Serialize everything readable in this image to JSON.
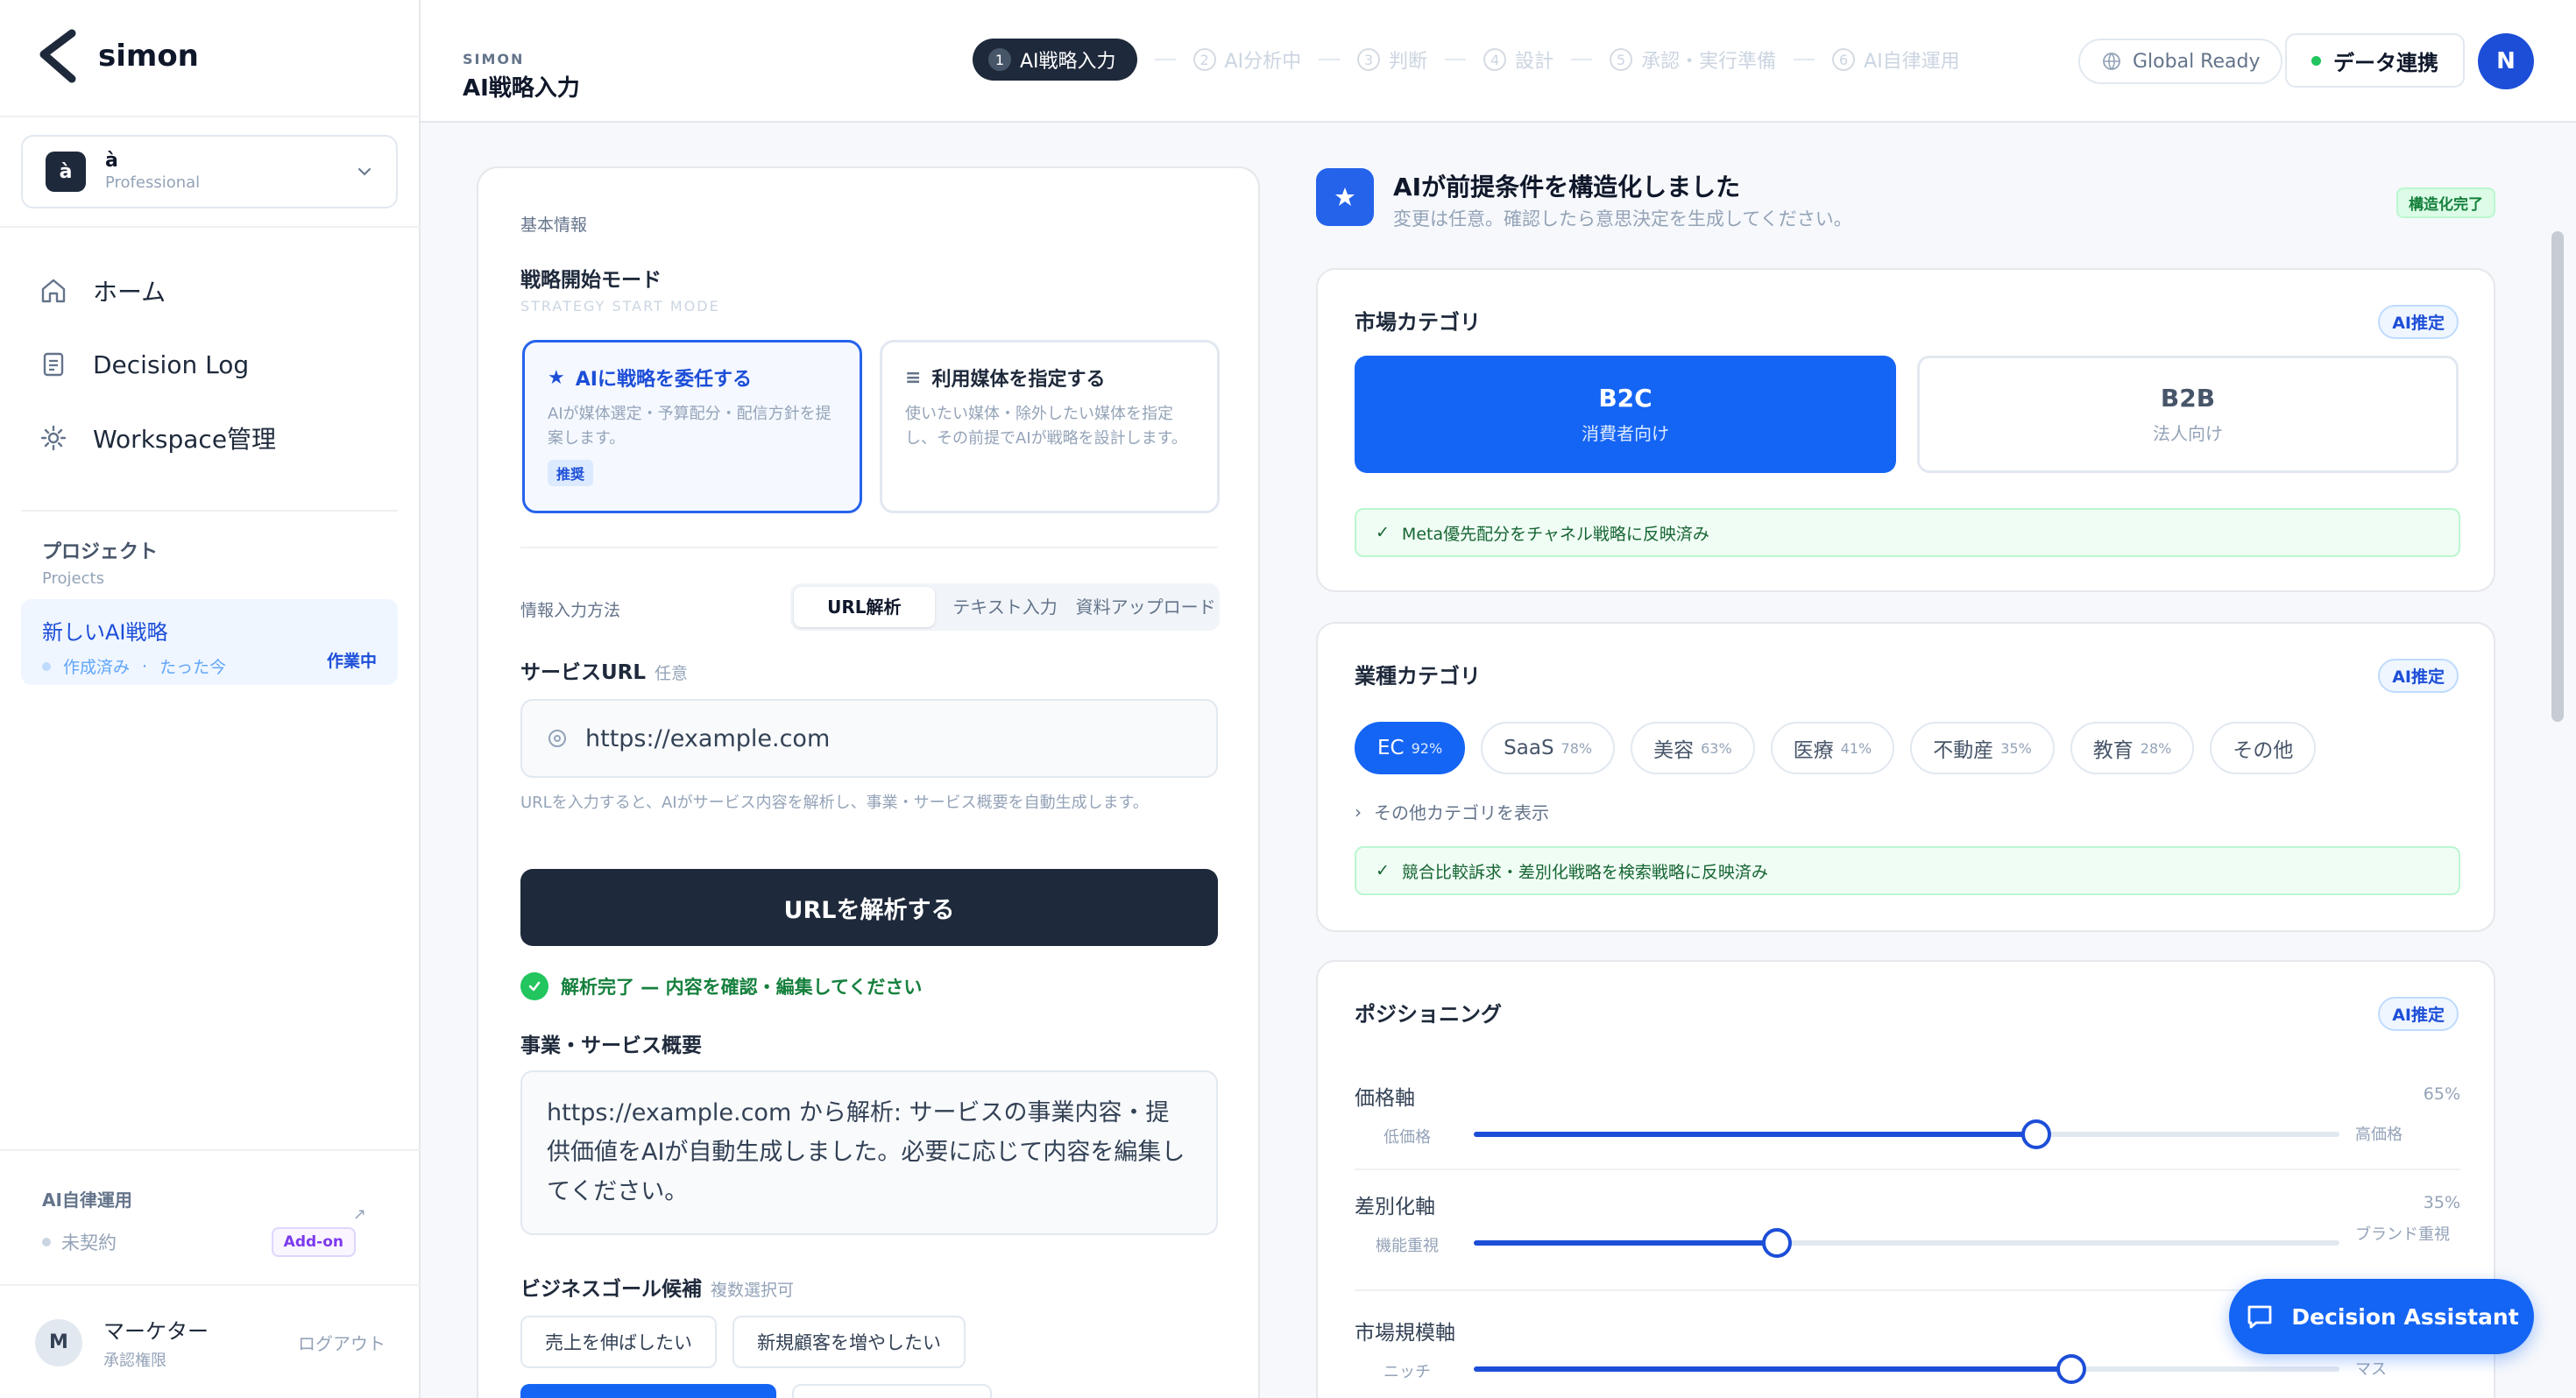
{
  "app": {
    "name": "simon"
  },
  "workspace": {
    "initial": "à",
    "name": "à",
    "plan": "Professional"
  },
  "nav": [
    {
      "label": "ホーム",
      "icon": "home-icon"
    },
    {
      "label": "Decision Log",
      "icon": "document-icon"
    },
    {
      "label": "Workspace管理",
      "icon": "gear-icon"
    }
  ],
  "projects": {
    "title": "プロジェクト",
    "subtitle": "Projects",
    "current": {
      "name": "新しいAI戦略",
      "created": "作成済み",
      "time": "たった今",
      "status": "作業中"
    }
  },
  "autonomous": {
    "title": "AI自律運用",
    "status": "未契約",
    "badge": "Add-on"
  },
  "user": {
    "initial": "M",
    "name": "マーケター",
    "role": "承認権限",
    "logout": "ログアウト"
  },
  "header": {
    "crumb": "SIMON",
    "title": "AI戦略入力",
    "steps": [
      {
        "num": "1",
        "label": "AI戦略入力"
      },
      {
        "num": "2",
        "label": "AI分析中"
      },
      {
        "num": "3",
        "label": "判断"
      },
      {
        "num": "4",
        "label": "設計"
      },
      {
        "num": "5",
        "label": "承認・実行準備"
      },
      {
        "num": "6",
        "label": "AI自律運用"
      }
    ],
    "global": "Global Ready",
    "datalink": "データ連携",
    "avatar": "N"
  },
  "form": {
    "section_label": "基本情報",
    "mode_title": "戦略開始モード",
    "mode_sub": "STRATEGY START MODE",
    "mode_ai": {
      "title": "AIに戦略を委任する",
      "desc": "AIが媒体選定・予算配分・配信方針を提案します。",
      "badge": "推奨"
    },
    "mode_media": {
      "title": "利用媒体を指定する",
      "desc": "使いたい媒体・除外したい媒体を指定し、その前提でAIが戦略を設計します。"
    },
    "input_method_label": "情報入力方法",
    "input_tabs": [
      "URL解析",
      "テキスト入力",
      "資料アップロード"
    ],
    "url_title": "サービスURL",
    "url_optional": "任意",
    "url_value": "https://example.com",
    "url_hint": "URLを入力すると、AIがサービス内容を解析し、事業・サービス概要を自動生成します。",
    "analyze_button": "URLを解析する",
    "done_message": "解析完了 — 内容を確認・編集してください",
    "summary_title": "事業・サービス概要",
    "summary_text": "https://example.com から解析: サービスの事業内容・提供価値をAIが自動生成しました。必要に応じて内容を編集してください。",
    "goals_title": "ビジネスゴール候補",
    "goals_note": "複数選択可",
    "goals": [
      "売上を伸ばしたい",
      "新規顧客を増やしたい"
    ]
  },
  "ai_panel": {
    "title": "AIが前提条件を構造化しました",
    "subtitle": "変更は任意。確認したら意思決定を生成してください。",
    "badge": "構造化完了"
  },
  "market": {
    "title": "市場カテゴリ",
    "badge": "AI推定",
    "options": [
      {
        "title": "B2C",
        "sub": "消費者向け"
      },
      {
        "title": "B2B",
        "sub": "法人向け"
      }
    ],
    "note": "Meta優先配分をチャネル戦略に反映済み"
  },
  "industry": {
    "title": "業種カテゴリ",
    "badge": "AI推定",
    "chips": [
      {
        "label": "EC",
        "pct": "92%"
      },
      {
        "label": "SaaS",
        "pct": "78%"
      },
      {
        "label": "美容",
        "pct": "63%"
      },
      {
        "label": "医療",
        "pct": "41%"
      },
      {
        "label": "不動産",
        "pct": "35%"
      },
      {
        "label": "教育",
        "pct": "28%"
      },
      {
        "label": "その他",
        "pct": ""
      }
    ],
    "more": "その他カテゴリを表示",
    "note": "競合比較訴求・差別化戦略を検索戦略に反映済み"
  },
  "positioning": {
    "title": "ポジショニング",
    "badge": "AI推定",
    "sliders": [
      {
        "label": "価格軸",
        "value_text": "65%",
        "value": 65,
        "left": "低価格",
        "right": "高価格"
      },
      {
        "label": "差別化軸",
        "value_text": "35%",
        "value": 35,
        "left": "機能重視",
        "right": "ブランド重視"
      },
      {
        "label": "市場規模軸",
        "value_text": "",
        "value": 69,
        "left": "ニッチ",
        "right": "マス"
      }
    ]
  },
  "assistant": {
    "label": "Decision Assistant"
  },
  "colors": {
    "accent": "#1565f5",
    "dark": "#1e293b",
    "success": "#22c55e"
  }
}
